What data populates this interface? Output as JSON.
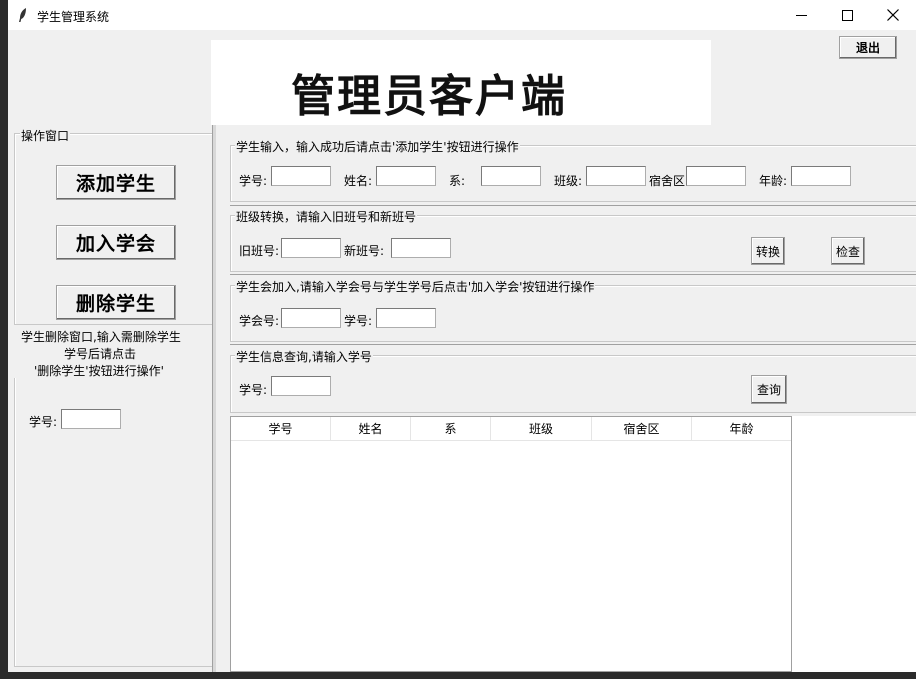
{
  "window": {
    "title": "学生管理系统",
    "minimize_glyph": "—",
    "maximize_glyph": "☐",
    "close_glyph": "✕"
  },
  "header": {
    "banner": "管理员客户端",
    "exit_label": "退出"
  },
  "left_panel": {
    "ops_legend": "操作窗口",
    "add_student_label": "添加学生",
    "join_union_label": "加入学会",
    "delete_student_label": "删除学生",
    "delete_legend_line1": "学生删除窗口,输入需删除学生",
    "delete_legend_line2": "学号后请点击",
    "delete_legend_line3": "'删除学生'按钮进行操作'",
    "delete_id_label": "学号:",
    "delete_id_value": ""
  },
  "add_section": {
    "legend": "学生输入，输入成功后请点击'添加学生'按钮进行操作",
    "fields": [
      {
        "label": "学号:",
        "value": ""
      },
      {
        "label": "姓名:",
        "value": ""
      },
      {
        "label": "系:",
        "value": ""
      },
      {
        "label": "班级:",
        "value": ""
      },
      {
        "label": "宿舍区",
        "value": ""
      },
      {
        "label": "年龄:",
        "value": ""
      }
    ]
  },
  "class_section": {
    "legend": "班级转换，请输入旧班号和新班号",
    "old_label": "旧班号:",
    "old_value": "",
    "new_label": "新班号:",
    "new_value": "",
    "convert_label": "转换",
    "check_label": "检查"
  },
  "union_section": {
    "legend": "学生会加入,请输入学会号与学生学号后点击'加入学会'按钮进行操作",
    "union_label": "学会号:",
    "union_value": "",
    "id_label": "学号:",
    "id_value": ""
  },
  "query_section": {
    "legend": "学生信息查询,请输入学号",
    "id_label": "学号:",
    "id_value": "",
    "query_label": "查询"
  },
  "table": {
    "columns": [
      "学号",
      "姓名",
      "系",
      "班级",
      "宿舍区",
      "年龄"
    ],
    "rows": []
  }
}
